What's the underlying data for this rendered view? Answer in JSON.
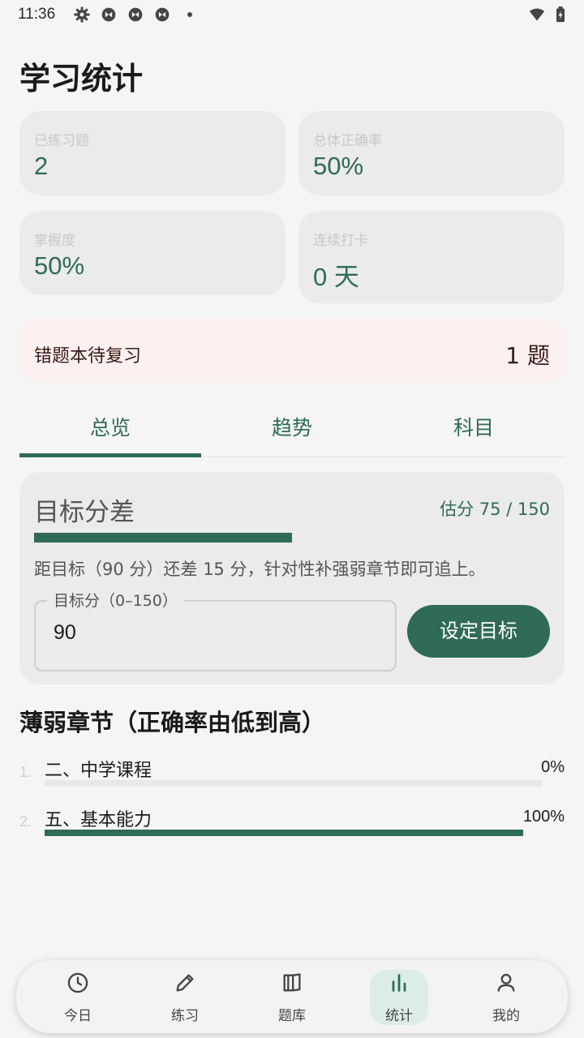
{
  "status_bar": {
    "time": "11:36",
    "icons": [
      "settings-icon",
      "sync-icon",
      "sync-icon",
      "sync-icon",
      "dot-icon",
      "wifi-icon",
      "battery-icon"
    ]
  },
  "page": {
    "title": "学习统计"
  },
  "stats": [
    {
      "label": "已练习题",
      "value": "2"
    },
    {
      "label": "总体正确率",
      "value": "50%"
    },
    {
      "label": "掌握度",
      "value": "50%"
    },
    {
      "label": "连续打卡",
      "value": "0 天"
    }
  ],
  "wrong_book": {
    "label": "错题本待复习",
    "count": "1 题"
  },
  "tabs": [
    {
      "label": "总览",
      "active": true
    },
    {
      "label": "趋势",
      "active": false
    },
    {
      "label": "科目",
      "active": false
    }
  ],
  "goal": {
    "title": "目标分差",
    "estimate": "估分 75 / 150",
    "progress": 0.5,
    "description": "距目标（90 分）还差 15 分，针对性补强弱章节即可追上。",
    "field_label": "目标分（0–150）",
    "field_value": "90",
    "button_label": "设定目标"
  },
  "weak_chapters": {
    "title": "薄弱章节（正确率由低到高）",
    "items": [
      {
        "index": "1.",
        "name": "二、中学课程",
        "percent_label": "0%",
        "accuracy": 0
      },
      {
        "index": "2.",
        "name": "五、基本能力",
        "percent_label": "100%",
        "accuracy": 1
      }
    ]
  },
  "bottom_nav": [
    {
      "label": "今日",
      "icon": "clock-icon",
      "active": false
    },
    {
      "label": "练习",
      "icon": "pencil-icon",
      "active": false
    },
    {
      "label": "题库",
      "icon": "book-icon",
      "active": false
    },
    {
      "label": "统计",
      "icon": "bar-chart-icon",
      "active": true
    },
    {
      "label": "我的",
      "icon": "person-icon",
      "active": false
    }
  ],
  "colors": {
    "accent": "#2f6b56",
    "background": "#f5f5f5",
    "card": "#ebebeb",
    "wrong_card": "#fcf1f0",
    "active_nav": "#dcede6"
  }
}
